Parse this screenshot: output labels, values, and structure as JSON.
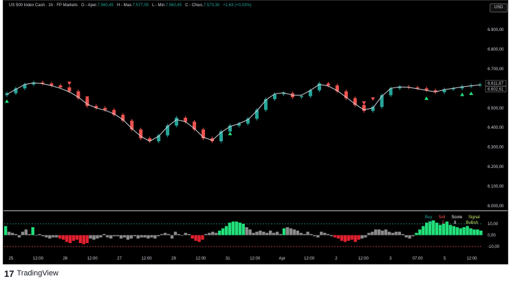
{
  "header": {
    "symbol": "US 500 Index Cash · 1h · FP Markets",
    "open_label": "O - Aper.",
    "open": "7.560,45",
    "high_label": "H - Max.",
    "high": "7.577,05",
    "low_label": "L - Min.",
    "low": "7.560,45",
    "close_label": "C - Chius.",
    "close": "7.573,30",
    "change": "+1,63 (+0,02%)"
  },
  "currency_button": "USD",
  "price_tags": [
    "6.611,87",
    "6.602,61"
  ],
  "indicator": {
    "headers": [
      "Buy",
      "Sell",
      "Score",
      "Signal"
    ],
    "values": [
      "13",
      "5",
      "8",
      "Bullish"
    ],
    "axis_labels": [
      "10,00",
      "0,00",
      "-10,00"
    ],
    "colors": {
      "buy": "#26a69a",
      "sell": "#ef5350",
      "score": "#ffffff",
      "signal": "#c6e86f"
    }
  },
  "footer": {
    "logo_glyph": "17",
    "brand": "TradingView"
  },
  "colors": {
    "up": "#26a69a",
    "down": "#ef5350",
    "wick": "#d1d4dc",
    "ma": "#d1d4dc",
    "bg": "#000000",
    "hist_neutral": "#8b8b8b",
    "hist_buy": "#22e07a",
    "hist_sell": "#e0202f",
    "dash_upper": "#26a69a",
    "dash_lower": "#ef5350"
  },
  "chart_data": [
    {
      "type": "line",
      "description_source": "candlestick price chart",
      "y_ticks": [
        "6.900,00",
        "6.800,00",
        "6.700,00",
        "6.600,00",
        "6.500,00",
        "6.400,00",
        "6.300,00",
        "6.200,00",
        "6.100,00",
        "6.000,00"
      ],
      "ylim": [
        6000,
        6900
      ],
      "x_ticks": [
        "25",
        "12:00",
        "26",
        "12:00",
        "27",
        "12:00",
        "29",
        "12:00",
        "31",
        "12:00",
        "Apr",
        "12:00",
        "2",
        "12:00",
        "3",
        "07:00",
        "5",
        "12:00"
      ],
      "series": [
        {
          "values": [
            6575,
            6600,
            6620,
            6630,
            6625,
            6615,
            6605,
            6585,
            6550,
            6510,
            6500,
            6490,
            6465,
            6435,
            6390,
            6345,
            6330,
            6360,
            6410,
            6450,
            6430,
            6390,
            6345,
            6330,
            6380,
            6410,
            6420,
            6445,
            6490,
            6545,
            6570,
            6575,
            6555,
            6560,
            6590,
            6625,
            6615,
            6585,
            6550,
            6515,
            6485,
            6505,
            6565,
            6600,
            6608,
            6605,
            6600,
            6590,
            6580,
            6595,
            6600,
            6610,
            6615,
            6620
          ]
        },
        {
          "values": [
            6570,
            6595,
            6620,
            6628,
            6624,
            6614,
            6600,
            6582,
            6555,
            6520,
            6500,
            6488,
            6470,
            6440,
            6395,
            6355,
            6330,
            6355,
            6405,
            6440,
            6430,
            6395,
            6350,
            6335,
            6375,
            6405,
            6420,
            6440,
            6485,
            6540,
            6572,
            6578,
            6565,
            6565,
            6590,
            6620,
            6612,
            6588,
            6555,
            6520,
            6490,
            6500,
            6560,
            6600,
            6608,
            6605,
            6598,
            6590,
            6582,
            6593,
            6600,
            6608,
            6613,
            6618
          ]
        }
      ],
      "buy_signal_indices": [
        0,
        25,
        47,
        51,
        52
      ],
      "sell_signal_indices": [
        7,
        9,
        40,
        41
      ]
    },
    {
      "type": "bar",
      "description_source": "histogram oscillator",
      "ylim": [
        -10,
        10
      ],
      "ticks": [
        10,
        0,
        -10
      ],
      "values": [
        8,
        3,
        2,
        1,
        -2,
        3,
        5,
        1,
        7,
        0,
        1,
        -1,
        -2,
        -3,
        -2,
        -2,
        -3,
        -4,
        -6,
        -7,
        -5,
        -4,
        -7,
        -8,
        -7,
        -3,
        -4,
        -3,
        -2,
        1,
        -2,
        -3,
        -1,
        -1,
        -3,
        -2,
        -4,
        -3,
        -1,
        -3,
        -2,
        -2,
        -3,
        -2,
        -3,
        -1,
        1,
        2,
        1,
        -3,
        3,
        1,
        0,
        2,
        1,
        -3,
        -5,
        -6,
        -4,
        1,
        2,
        3,
        2,
        4,
        6,
        8,
        11,
        12,
        12,
        11,
        10,
        7,
        5,
        2,
        3,
        4,
        3,
        2,
        4,
        2,
        3,
        1,
        6,
        7,
        6,
        5,
        4,
        2,
        1,
        3,
        1,
        -1,
        -2,
        3,
        2,
        1,
        -1,
        -2,
        -3,
        -5,
        -6,
        -5,
        -4,
        -6,
        -4,
        -3,
        -2,
        2,
        3,
        5,
        5,
        4,
        5,
        3,
        2,
        3,
        3,
        1,
        -2,
        -3,
        -1,
        2,
        5,
        8,
        11,
        12,
        13,
        11,
        9,
        10,
        12,
        9,
        8,
        7,
        6,
        7,
        8,
        6,
        5,
        5,
        4
      ],
      "buy_indices": [
        0,
        8,
        63,
        64,
        65,
        66,
        67,
        68,
        69,
        70,
        82,
        121,
        122,
        123,
        124,
        125,
        126,
        127,
        128,
        129,
        130,
        131,
        132,
        133,
        134,
        135,
        136,
        137,
        138,
        139,
        140
      ],
      "sell_indices": [
        16,
        17,
        18,
        19,
        20,
        21,
        22,
        23,
        24,
        55,
        56,
        57,
        58,
        97,
        98,
        99,
        100,
        101,
        102,
        103,
        104
      ]
    }
  ]
}
